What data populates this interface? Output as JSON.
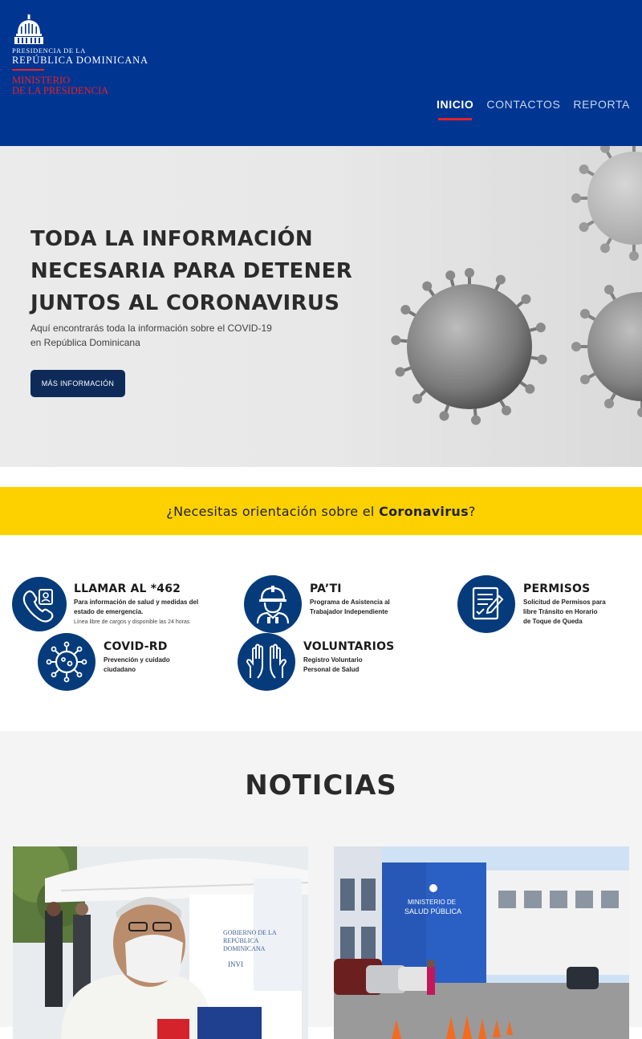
{
  "header": {
    "logo": {
      "line1": "PRESIDENCIA DE LA",
      "line2": "REPÚBLICA DOMINICANA",
      "ministry_line1": "MINISTERIO",
      "ministry_line2": "DE LA PRESIDENCIA"
    },
    "nav": [
      {
        "label": "INICIO",
        "active": true
      },
      {
        "label": "CONTACTOS",
        "active": false
      },
      {
        "label": "REPORTA",
        "active": false
      }
    ]
  },
  "hero": {
    "title_line1": "TODA LA INFORMACIÓN",
    "title_line2": "NECESARIA PARA DETENER",
    "title_line3": "JUNTOS AL CORONAVIRUS",
    "subtitle_line1": "Aquí encontrarás toda la información sobre el COVID-19",
    "subtitle_line2": "en República Dominicana",
    "button_label": "MÁS INFORMACIÓN"
  },
  "banner": {
    "text_before": "¿Necesitas orientación sobre el ",
    "text_bold": "Coronavirus",
    "text_after": "?"
  },
  "services": [
    {
      "icon": "phone-icon",
      "title": "LLAMAR AL *462",
      "desc_line1": "Para información de salud y medidas del",
      "desc_line2": "estado de emergencia.",
      "note": "Línea libre de cargos y disponible las 24 horas"
    },
    {
      "icon": "worker-icon",
      "title": "PA’TI",
      "desc_line1": "Programa de Asistencia al",
      "desc_line2": "Trabajador Independiente"
    },
    {
      "icon": "permit-document-icon",
      "title": "PERMISOS",
      "desc_line1": "Solicitud de Permisos para",
      "desc_line2": "libre Tránsito en Horario",
      "desc_line3": "de Toque de Queda"
    },
    {
      "icon": "virus-icon",
      "title": "COVID-RD",
      "desc_line1": "Prevención y cuidado",
      "desc_line2": "ciudadano"
    },
    {
      "icon": "raised-hands-icon",
      "title": "VOLUNTARIOS",
      "desc_line1": "Registro Voluntario",
      "desc_line2": "Personal de Salud"
    }
  ],
  "news": {
    "title": "NOTICIAS",
    "cards": [
      {
        "image": "official-speaking-to-press-photo",
        "sign_line1": "GOBIERNO DE LA",
        "sign_line2": "REPÚBLICA",
        "sign_line3": "DOMINICANA",
        "sign_line4": "INVI"
      },
      {
        "image": "ministry-of-public-health-building-photo",
        "sign_line1": "MINISTERIO DE",
        "sign_line2": "SALUD PÚBLICA"
      }
    ]
  },
  "colors": {
    "header_bg": "#003592",
    "accent_red": "#e3232b",
    "banner_yellow": "#fdd100",
    "icon_blue": "#063b7b",
    "button_dark": "#0e2a59"
  }
}
